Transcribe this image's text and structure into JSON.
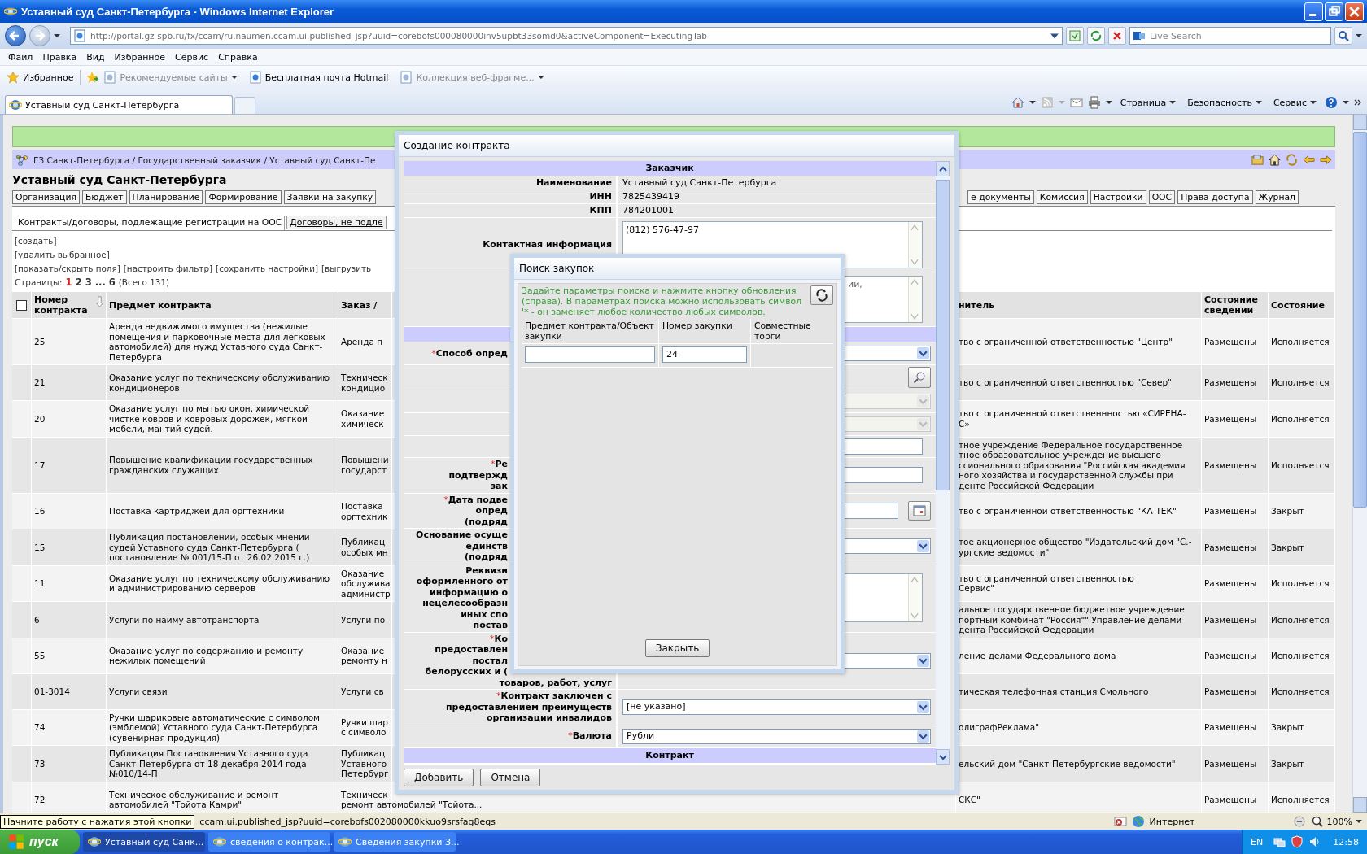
{
  "window": {
    "title": "Уставный суд Санкт-Петербурга - Windows Internet Explorer"
  },
  "address_bar": {
    "url": "http://portal.gz-spb.ru/fx/ccam/ru.naumen.ccam.ui.published_jsp?uuid=corebofs000080000inv5upbt33somd0&activeComponent=ExecutingTab"
  },
  "search": {
    "placeholder": "Live Search"
  },
  "menu": [
    "Файл",
    "Правка",
    "Вид",
    "Избранное",
    "Сервис",
    "Справка"
  ],
  "favorites_bar": {
    "label": "Избранное",
    "items": [
      {
        "label": "Рекомендуемые сайты",
        "dimmed": true,
        "dropdown": true
      },
      {
        "label": "Бесплатная почта Hotmail",
        "dimmed": false,
        "dropdown": false
      },
      {
        "label": "Коллекция веб-фрагме...",
        "dimmed": true,
        "dropdown": true
      }
    ]
  },
  "browser_tabs": [
    {
      "label": "Уставный суд Санкт-Петербурга",
      "selected": true
    }
  ],
  "command_bar": [
    "Страница",
    "Безопасность",
    "Сервис"
  ],
  "page": {
    "breadcrumb": "ГЗ Санкт-Петербурга / Государственный заказчик / Уставный суд Санкт-Пе",
    "heading": "Уставный суд Санкт-Петербурга",
    "nav_tabs_left": [
      "Организация",
      "Бюджет",
      "Планирование",
      "Формирование",
      "Заявки на закупку"
    ],
    "nav_tabs_right": [
      "е документы",
      "Комиссия",
      "Настройки",
      "ООС",
      "Права доступа",
      "Журнал"
    ],
    "sub_tabs": [
      {
        "label": "Контракты/договоры, подлежащие регистрации на ООС",
        "selected": true
      },
      {
        "label": "Договоры, не подле",
        "selected": false
      }
    ],
    "actions": [
      "[создать]",
      "[удалить выбранное]"
    ],
    "toolbar_links": [
      "[показать/скрыть поля]",
      "[настроить фильтр]",
      "[сохранить настройки]",
      "[выгрузить"
    ],
    "pagination": {
      "label": "Страницы:",
      "pages": [
        {
          "label": "1",
          "selected": true
        },
        {
          "label": "2",
          "selected": false
        },
        {
          "label": "3",
          "selected": false
        },
        {
          "label": "...",
          "selected": false
        },
        {
          "label": "6",
          "selected": false
        }
      ],
      "total": "(Всего 131)"
    },
    "table": {
      "select_all": {
        "checked": false
      },
      "columns": [
        {
          "label": "Номер контракта",
          "sorted": true
        },
        {
          "label": "Предмет контракта",
          "sorted": false
        },
        {
          "label": "Заказ /",
          "sorted": false
        },
        {
          "label": "нитель",
          "sorted": false
        },
        {
          "label": "Состояние сведений",
          "sorted": false
        },
        {
          "label": "Состояние",
          "sorted": false
        }
      ],
      "rows": [
        {
          "number": "25",
          "subject": "Аренда недвижимого имущества (нежилые помещения и парковочные места для легковых автомобилей) для нужд Уставного суда Санкт-Петербурга",
          "column_3": "Аренда п",
          "executor": "тво с ограниченной ответственностью \"Центр\"",
          "info_state": "Размещены",
          "state": "Исполняется"
        },
        {
          "number": "21",
          "subject": "Оказание услуг по техническому обслуживанию кондиционеров",
          "column_3": "Техническ\nкондицио",
          "executor": "тво с ограниченной ответственностью \"Север\"",
          "info_state": "Размещены",
          "state": "Исполняется"
        },
        {
          "number": "20",
          "subject": "Оказание услуг по мытью окон, химической чистке ковров и ковровых дорожек, мягкой мебели, мантий судей.",
          "column_3": "Оказание\nхимическ",
          "executor": "тво с ограниченной ответственнностью «СИРЕНА-\nС»",
          "info_state": "Размещены",
          "state": "Исполняется"
        },
        {
          "number": "17",
          "subject": "Повышение квалификации государственных гражданских служащих",
          "column_3": "Повышени\nгосударст",
          "executor": "тное учреждение Федеральное государственное\nтное образовательное учреждение высшего\nссионального образования \"Российская академия\nного хозяйства и государственной службы при\nденте Российской Федерации",
          "info_state": "Размещены",
          "state": "Исполняется"
        },
        {
          "number": "16",
          "subject": "Поставка картриджей для оргтехники",
          "column_3": "Поставка\nоргтехник",
          "executor": "тво с ограниченной ответственностью \"КА-ТЕК\"",
          "info_state": "Размещены",
          "state": "Закрыт"
        },
        {
          "number": "15",
          "subject": "Публикация постановлений, особых мнений судей Уставного суда Санкт-Петербурга ( постановление № 001/15-П от 26.02.2015 г.)",
          "column_3": "Публикац\nособых мн",
          "executor": "тое акционерное общество \"Издательский дом \"С.-\nургские ведомости\"",
          "info_state": "Размещены",
          "state": "Закрыт"
        },
        {
          "number": "11",
          "subject": "Оказание услуг по техническому обслуживанию и администрированию серверов",
          "column_3": "Оказание\nобслужива\nадминистр",
          "executor": "тво с ограниченной ответственностью\nСервис\"",
          "info_state": "Размещены",
          "state": "Исполняется"
        },
        {
          "number": "6",
          "subject": "Услуги по найму автотранспорта",
          "column_3": "Услуги по",
          "executor": "альное государственное бюджетное учреждение\nпортный комбинат \"Россия\"\" Управление делами\nдента Российской Федерации",
          "info_state": "Размещены",
          "state": "Исполняется"
        },
        {
          "number": "55",
          "subject": "Оказание услуг по содержанию и ремонту нежилых помещений",
          "column_3": "Оказание\nремонту н",
          "executor": "ление делами Федерального дома",
          "info_state": "Размещены",
          "state": "Исполняется"
        },
        {
          "number": "01-3014",
          "subject": "Услуги связи",
          "column_3": "Услуги св",
          "executor": "тическая телефонная станция Смольного",
          "info_state": "Размещены",
          "state": "Исполняется"
        },
        {
          "number": "74",
          "subject": "Ручки шариковые автоматические с символом (эмблемой) Уставного суда Санкт-Петербурга (сувенирная продукция)",
          "column_3": "Ручки шар\nс символо",
          "executor": "олиграфРеклама\"",
          "info_state": "Размещены",
          "state": "Закрыт"
        },
        {
          "number": "73",
          "subject": "Публикация Постановления Уставного суда Санкт-Петербурга от 18 декабря 2014 года №010/14-П",
          "column_3": "Публикац\nУставного\nПетербург",
          "executor": "ельский дом \"Санкт-Петербургские ведомости\"",
          "info_state": "Размещены",
          "state": "Закрыт"
        },
        {
          "number": "72",
          "subject": "Техническое обслуживание и ремонт автомобилей \"Тойота Камри\"",
          "column_3": "Техническ\nремонт автомобилей \"Тойота...",
          "executor": "СКС\"",
          "info_state": "Размещены",
          "state": "Исполняется"
        }
      ]
    }
  },
  "contract_dialog": {
    "title": "Создание контракта",
    "rows": [
      {
        "kind": "section",
        "label": "Заказчик"
      },
      {
        "kind": "text",
        "label": [
          {
            "text": "Наименование",
            "cut": false
          }
        ],
        "value": "Уставный суд Санкт-Петербурга"
      },
      {
        "kind": "text",
        "label": [
          {
            "text": "ИНН",
            "cut": false
          }
        ],
        "value": "7825439419"
      },
      {
        "kind": "text",
        "label": [
          {
            "text": "КПП",
            "cut": false
          }
        ],
        "value": "784201001"
      },
      {
        "kind": "textarea",
        "label": [
          {
            "text": "Контактная информация",
            "cut": false
          }
        ],
        "value": "(812) 576-47-97",
        "cut": false
      },
      {
        "kind": "textarea",
        "value": "ий,",
        "cut": true
      },
      {
        "kind": "section"
      },
      {
        "kind": "select",
        "mark": "*",
        "label": [
          {
            "text": "Способ опред",
            "cut": true
          }
        ],
        "disabled": false
      },
      {
        "kind": "lookup"
      },
      {
        "kind": "select",
        "disabled": true
      },
      {
        "kind": "select",
        "disabled": true
      },
      {
        "kind": "input"
      },
      {
        "kind": "input",
        "mark": "*",
        "label": [
          {
            "text": "Ре",
            "cut": true
          },
          {
            "text": "подтвержд",
            "cut": true
          },
          {
            "text": "зак",
            "cut": true
          }
        ]
      },
      {
        "kind": "date",
        "mark": "*",
        "label": [
          {
            "text": "Дата подве",
            "cut": true
          },
          {
            "text": "опред",
            "cut": true
          },
          {
            "text": "(подряд",
            "cut": true
          }
        ]
      },
      {
        "kind": "select",
        "label": [
          {
            "text": "Основание осуще",
            "cut": true
          },
          {
            "text": "единств",
            "cut": true
          },
          {
            "text": "(подряд",
            "cut": true
          }
        ],
        "disabled": false
      },
      {
        "kind": "textarea",
        "label": [
          {
            "text": "Реквизи",
            "cut": true
          },
          {
            "text": "оформленного от",
            "cut": true
          },
          {
            "text": "информацию о",
            "cut": true
          },
          {
            "text": "нецелесообразн",
            "cut": true
          },
          {
            "text": "иных спо",
            "cut": true
          },
          {
            "text": "постав",
            "cut": true
          }
        ],
        "cut": false
      },
      {
        "kind": "select",
        "mark": "*",
        "label": [
          {
            "text": "Ко",
            "cut": true
          },
          {
            "text": "предоставлен",
            "cut": true
          },
          {
            "text": "постал",
            "cut": true
          },
          {
            "text": "белорусских и (",
            "cut": true
          },
          {
            "text": "товаров, работ, услуг",
            "cut": false
          }
        ],
        "disabled": false
      },
      {
        "kind": "select",
        "mark": "*",
        "label": [
          {
            "text": "Контракт заключен с",
            "cut": false
          },
          {
            "text": "предоставлением преимуществ",
            "cut": false
          },
          {
            "text": "организации инвалидов",
            "cut": false
          }
        ],
        "value": "[не указано]",
        "disabled": false
      },
      {
        "kind": "select",
        "mark": "*",
        "label": [
          {
            "text": "Валюта",
            "cut": false
          }
        ],
        "value": "Рубли",
        "disabled": false
      },
      {
        "kind": "section",
        "label": "Контракт"
      }
    ],
    "buttons": [
      "Добавить",
      "Отмена"
    ]
  },
  "search_dialog": {
    "title": "Поиск закупок",
    "hint": "Задайте параметры поиска и нажмите кнопку обновления (справа). В параметрах поиска можно использовать символ '* - он заменяет любое количество любых символов.",
    "filters": [
      {
        "label": "Предмет контракта/Объект закупки",
        "kind": "input"
      },
      {
        "label": "Номер закупки",
        "kind": "input",
        "value": "24"
      },
      {
        "label": "Совместные торги",
        "kind": "none"
      }
    ],
    "close_button": "Закрыть"
  },
  "status_bar": {
    "tooltip": "Начните работу с нажатия этой кнопки",
    "text": "ccam.ui.published_jsp?uuid=corebofs002080000kkuo9srsfag8eqs",
    "zone": "Интернет",
    "zoom": "100%"
  },
  "taskbar": {
    "start": "пуск",
    "tasks": [
      {
        "label": "Уставный суд Санк...",
        "selected": true
      },
      {
        "label": "сведения о контрак...",
        "selected": false
      },
      {
        "label": "Сведения закупки З...",
        "selected": false
      }
    ],
    "language": "EN",
    "clock": "12:58"
  }
}
